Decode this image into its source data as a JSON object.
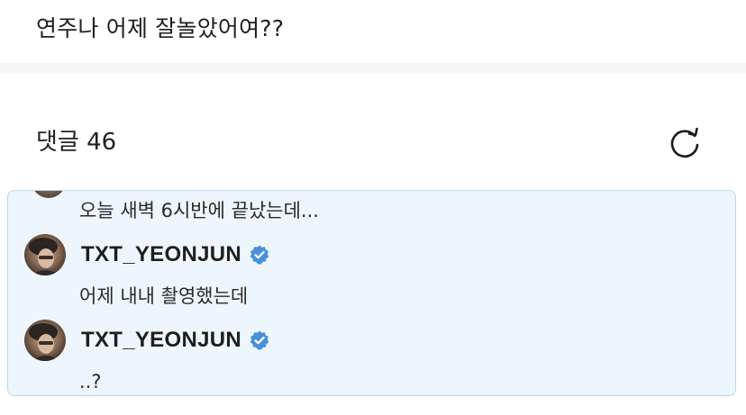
{
  "post": {
    "text": "연주나 어제 잘놀았어여??"
  },
  "comments": {
    "title": "댓글 46",
    "refresh_icon": "refresh-icon"
  },
  "thread": {
    "items": [
      {
        "text": "오늘 새벽 6시반에 끝났는데..."
      },
      {
        "author": "TXT_YEONJUN",
        "verified": true,
        "text": "어제 내내 촬영했는데"
      },
      {
        "author": "TXT_YEONJUN",
        "verified": true,
        "text": "..?"
      }
    ]
  },
  "colors": {
    "thread_bg": "#edf6fc",
    "thread_border": "#bcd8ec",
    "verified_blue": "#4a90d9"
  }
}
